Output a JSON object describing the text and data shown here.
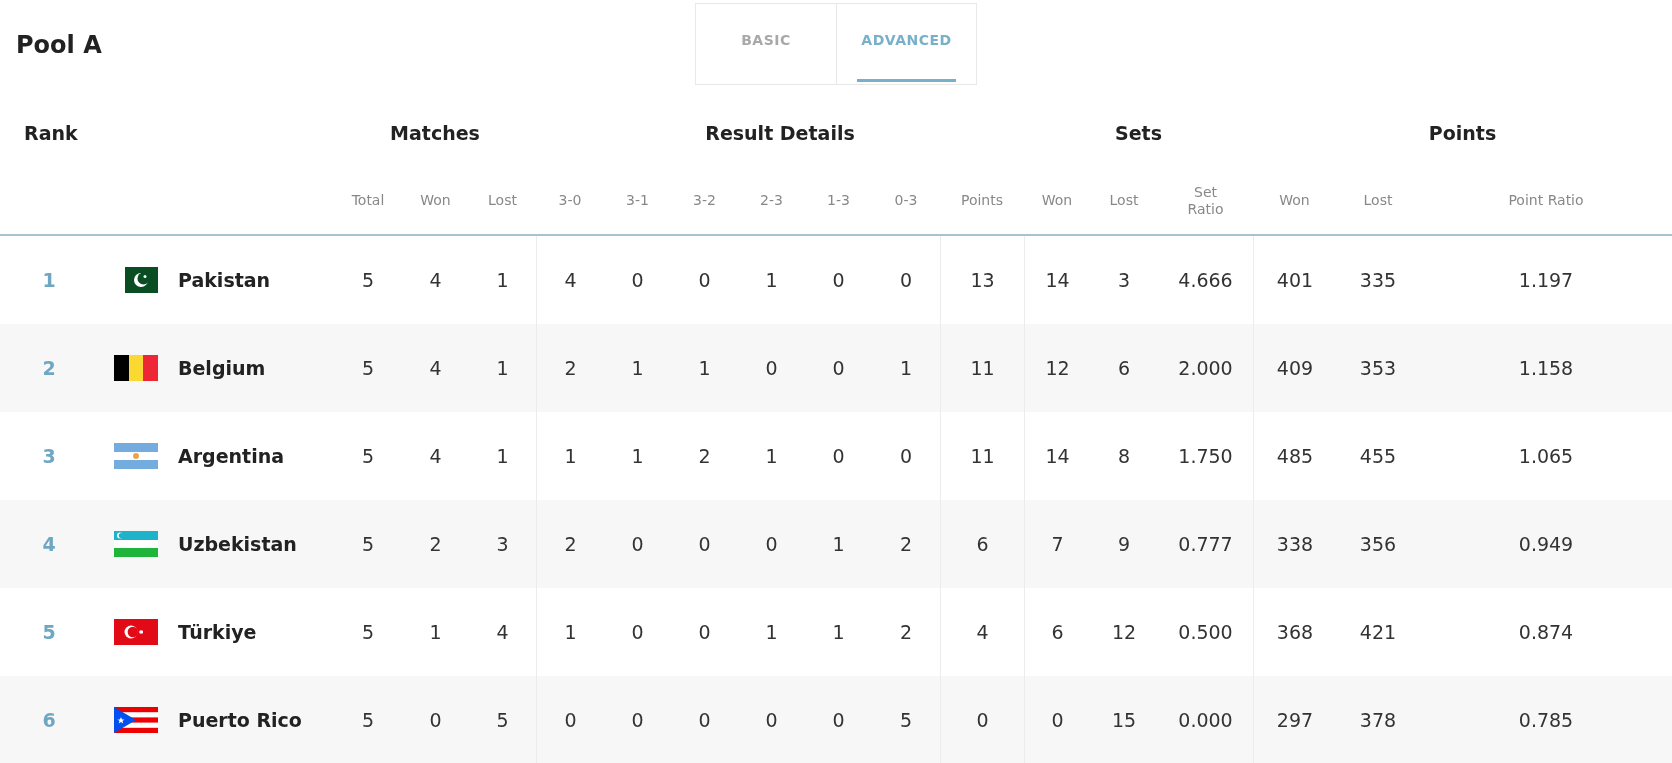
{
  "title": "Pool A",
  "tabs": [
    {
      "label": "BASIC",
      "selected": false
    },
    {
      "label": "ADVANCED",
      "selected": true
    }
  ],
  "group_headers": [
    "Rank",
    "Matches",
    "Result Details",
    "Sets",
    "Points"
  ],
  "columns": [
    "Total",
    "Won",
    "Lost",
    "3-0",
    "3-1",
    "3-2",
    "2-3",
    "1-3",
    "0-3",
    "Points",
    "Won",
    "Lost",
    "Set Ratio",
    "Won",
    "Lost",
    "Point Ratio"
  ],
  "rows": [
    {
      "rank": "1",
      "kind": "pk",
      "team": "Pakistan",
      "cells": [
        "5",
        "4",
        "1",
        "4",
        "0",
        "0",
        "1",
        "0",
        "0",
        "13",
        "14",
        "3",
        "4.666",
        "401",
        "335",
        "1.197"
      ]
    },
    {
      "rank": "2",
      "kind": "be",
      "team": "Belgium",
      "cells": [
        "5",
        "4",
        "1",
        "2",
        "1",
        "1",
        "0",
        "0",
        "1",
        "11",
        "12",
        "6",
        "2.000",
        "409",
        "353",
        "1.158"
      ]
    },
    {
      "rank": "3",
      "kind": "ar",
      "team": "Argentina",
      "cells": [
        "5",
        "4",
        "1",
        "1",
        "1",
        "2",
        "1",
        "0",
        "0",
        "11",
        "14",
        "8",
        "1.750",
        "485",
        "455",
        "1.065"
      ]
    },
    {
      "rank": "4",
      "kind": "uz",
      "team": "Uzbekistan",
      "cells": [
        "5",
        "2",
        "3",
        "2",
        "0",
        "0",
        "0",
        "1",
        "2",
        "6",
        "7",
        "9",
        "0.777",
        "338",
        "356",
        "0.949"
      ]
    },
    {
      "rank": "5",
      "kind": "tr",
      "team": "Türkiye",
      "cells": [
        "5",
        "1",
        "4",
        "1",
        "0",
        "0",
        "1",
        "1",
        "2",
        "4",
        "6",
        "12",
        "0.500",
        "368",
        "421",
        "0.874"
      ]
    },
    {
      "rank": "6",
      "kind": "pr",
      "team": "Puerto Rico",
      "cells": [
        "5",
        "0",
        "5",
        "0",
        "0",
        "0",
        "0",
        "0",
        "5",
        "0",
        "0",
        "15",
        "0.000",
        "297",
        "378",
        "0.785"
      ]
    }
  ]
}
